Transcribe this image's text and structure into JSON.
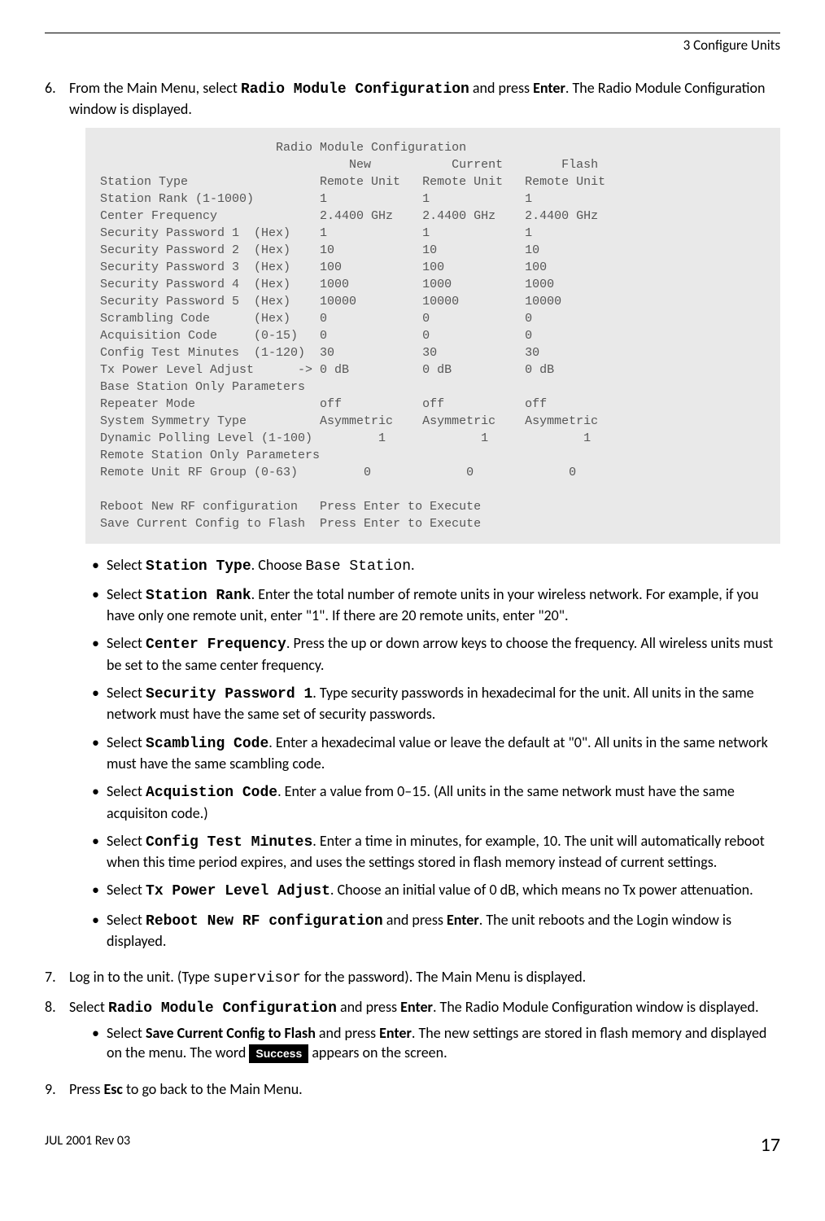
{
  "header": {
    "chapter": "3 Configure Units"
  },
  "step6": {
    "num": "6.",
    "text_before": "From the Main Menu, select ",
    "code1": "Radio Module Configuration",
    "text_mid": " and press ",
    "key": "Enter",
    "text_after": ". The Radio Module Configuration window is displayed."
  },
  "terminal": {
    "title": "Radio Module Configuration",
    "col1": "New",
    "col2": "Current",
    "col3": "Flash",
    "rows": [
      {
        "label": "Station Type",
        "note": "",
        "c1": "Remote Unit",
        "c2": "Remote Unit",
        "c3": "Remote Unit"
      },
      {
        "label": "Station Rank (1-1000)",
        "note": "",
        "c1": "1",
        "c2": "1",
        "c3": "1"
      },
      {
        "label": "Center Frequency",
        "note": "",
        "c1": "2.4400 GHz",
        "c2": "2.4400 GHz",
        "c3": "2.4400 GHz"
      },
      {
        "label": "Security Password 1",
        "note": "(Hex)",
        "c1": "1",
        "c2": "1",
        "c3": "1"
      },
      {
        "label": "Security Password 2",
        "note": "(Hex)",
        "c1": "10",
        "c2": "10",
        "c3": "10"
      },
      {
        "label": "Security Password 3",
        "note": "(Hex)",
        "c1": "100",
        "c2": "100",
        "c3": "100"
      },
      {
        "label": "Security Password 4",
        "note": "(Hex)",
        "c1": "1000",
        "c2": "1000",
        "c3": "1000"
      },
      {
        "label": "Security Password 5",
        "note": "(Hex)",
        "c1": "10000",
        "c2": "10000",
        "c3": "10000"
      },
      {
        "label": "Scrambling Code",
        "note": "(Hex)",
        "c1": "0",
        "c2": "0",
        "c3": "0"
      },
      {
        "label": "Acquisition Code",
        "note": "(0-15)",
        "c1": "0",
        "c2": "0",
        "c3": "0"
      },
      {
        "label": "Config Test Minutes",
        "note": "(1-120)",
        "c1": "30",
        "c2": "30",
        "c3": "30"
      },
      {
        "label": "Tx Power Level Adjust",
        "note": "->",
        "c1": "0 dB",
        "c2": "0 dB",
        "c3": "0 dB"
      },
      {
        "label": "Base Station Only Parameters",
        "note": "",
        "c1": "",
        "c2": "",
        "c3": ""
      },
      {
        "label": "Repeater Mode",
        "note": "",
        "c1": "off",
        "c2": "off",
        "c3": "off"
      },
      {
        "label": "System Symmetry Type",
        "note": "",
        "c1": "Asymmetric",
        "c2": "Asymmetric",
        "c3": "Asymmetric"
      },
      {
        "label": "Dynamic Polling Level (1-100)",
        "note": "",
        "c1": "1",
        "c2": "1",
        "c3": "1"
      },
      {
        "label": "Remote Station Only Parameters",
        "note": "",
        "c1": "",
        "c2": "",
        "c3": ""
      },
      {
        "label": "Remote Unit RF Group (0-63)",
        "note": "",
        "c1": "0",
        "c2": "0",
        "c3": "0"
      }
    ],
    "action1_label": "Reboot New RF configuration",
    "action1_text": "Press Enter to Execute",
    "action2_label": "Save Current Config to Flash",
    "action2_text": "Press Enter to Execute"
  },
  "bullets6": {
    "b1": {
      "pre": "Select ",
      "code": "Station Type",
      "mid": ". Choose ",
      "mono": "Base Station",
      "post": "."
    },
    "b2": {
      "pre": "Select ",
      "code": "Station Rank",
      "post": ". Enter the total number of remote units in your wireless network. For example, if you have only one remote unit, enter \"1\". If there are 20 remote units, enter \"20\"."
    },
    "b3": {
      "pre": " Select ",
      "code": "Center Frequency",
      "post": ". Press the up or down arrow keys to choose the frequency. All wireless units must be set to the same center frequency."
    },
    "b4": {
      "pre": "Select ",
      "code": "Security Password 1",
      "post": ". Type security passwords in hexadecimal for the unit. All units in the same network must have the same set of security passwords."
    },
    "b5": {
      "pre": "Select ",
      "code": "Scambling Code",
      "post": ". Enter a hexadecimal value or leave the default at \"0\". All units in the same network must have the same scambling code."
    },
    "b6": {
      "pre": "Select ",
      "code": "Acquistion Code",
      "post": ". Enter a value from 0–15. (All units in the same network must have the same acquisiton code.)"
    },
    "b7": {
      "pre": "Select ",
      "code": "Config Test Minutes",
      "post": ". Enter a time in minutes, for example, 10. The unit will automatically reboot when this time period expires, and uses the settings stored in flash memory instead of current settings."
    },
    "b8": {
      "pre": "Select ",
      "code": "Tx Power Level Adjust",
      "post": ". Choose an initial value of 0 dB, which means no Tx power attenuation."
    },
    "b9": {
      "pre": "Select ",
      "code": "Reboot New RF configuration",
      "mid": " and press ",
      "key": "Enter",
      "post": ". The unit reboots and the Login window is displayed."
    }
  },
  "step7": {
    "num": "7.",
    "pre": "Log in to the unit. (Type ",
    "mono": "supervisor",
    "post": " for the password). The Main Menu is displayed."
  },
  "step8": {
    "num": "8.",
    "pre": "Select ",
    "code": "Radio Module Configuration",
    "mid": " and press ",
    "key": "Enter",
    "post": ". The Radio Module Configuration window is displayed.",
    "bullet": {
      "pre": "Select ",
      "bold": "Save Current Config to Flash",
      "mid": " and press ",
      "key": "Enter",
      "part2a": ". The new settings are stored in flash memory and displayed on the menu. The word ",
      "chip": "Success",
      "part2b": " appears on the screen."
    }
  },
  "step9": {
    "num": "9.",
    "pre": "Press ",
    "key": "Esc",
    "post": " to go back to the Main Menu."
  },
  "footer": {
    "left": "JUL 2001 Rev 03",
    "right": "17"
  }
}
